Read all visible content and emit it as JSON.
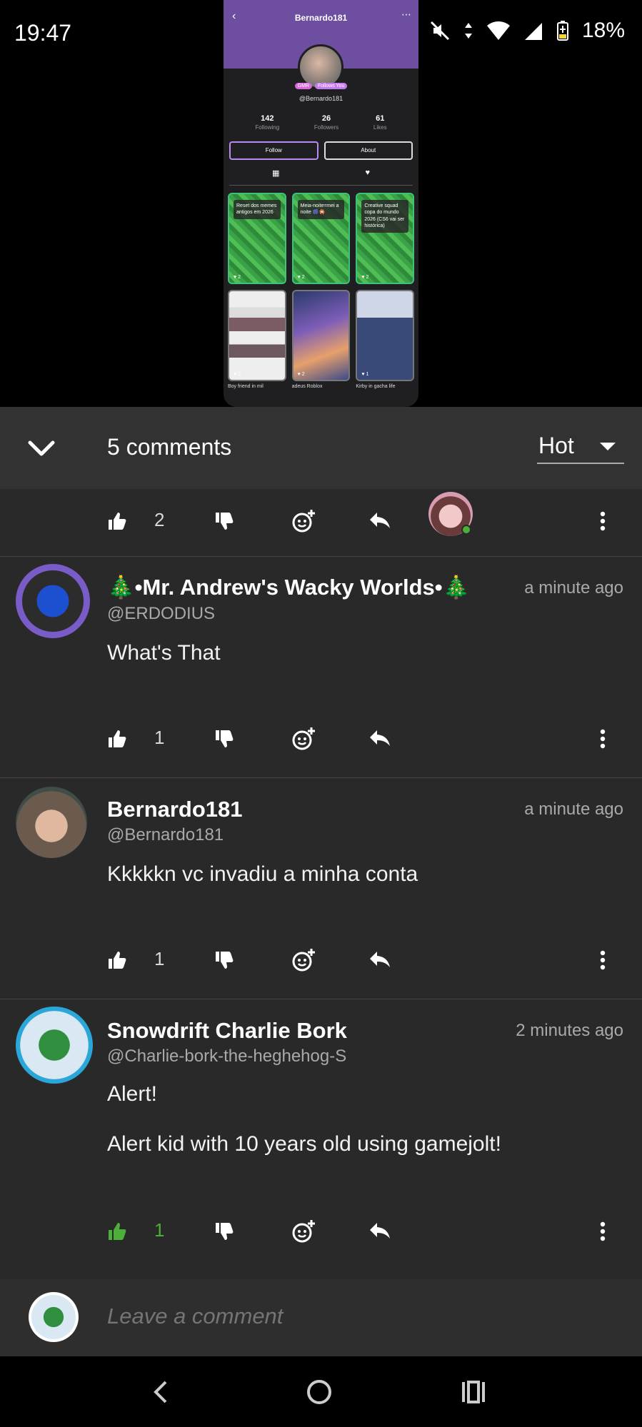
{
  "status_bar": {
    "time": "19:47",
    "battery": "18%",
    "icons": [
      "mute-icon",
      "data-icon",
      "wifi-icon",
      "signal-icon",
      "battery-icon"
    ]
  },
  "preview": {
    "title": "Bernardo181",
    "badges": [
      "GMR",
      "Follows You"
    ],
    "handle": "@Bernardo181",
    "stats": [
      {
        "value": "142",
        "label": "Following"
      },
      {
        "value": "26",
        "label": "Followers"
      },
      {
        "value": "61",
        "label": "Likes"
      }
    ],
    "buttons": {
      "follow": "Follow",
      "about": "About"
    },
    "posts": [
      {
        "caption": "Reset dos memes antigos em 2026",
        "likes": "2"
      },
      {
        "caption": "Meia-noite=mei a noite 🎆🎇",
        "likes": "2"
      },
      {
        "caption": "Creative squad copa do mundo 2026 (CS6 vai ser histórica)",
        "likes": "2"
      }
    ],
    "posts_row2": [
      {
        "label": "Boy friend in mil",
        "likes": "2"
      },
      {
        "label": "adeus Roblox",
        "likes": "2"
      },
      {
        "label": "Kirby in gacha life",
        "likes": "1"
      }
    ]
  },
  "panel": {
    "comments_count": "5 comments",
    "sort": "Hot"
  },
  "top_partial_actions": {
    "likes": "2"
  },
  "comments": [
    {
      "name": "🎄•Mr. Andrew's Wacky Worlds•🎄",
      "handle": "@ERDODIUS",
      "time": "a minute ago",
      "body": [
        "What's That"
      ],
      "likes": "1",
      "liked": false
    },
    {
      "name": "Bernardo181",
      "handle": "@Bernardo181",
      "time": "a minute ago",
      "body": [
        "Kkkkkn vc invadiu a minha conta"
      ],
      "likes": "1",
      "liked": false
    },
    {
      "name": "Snowdrift Charlie Bork",
      "handle": "@Charlie-bork-the-heghehog-S",
      "time": "2 minutes ago",
      "body": [
        "Alert!",
        "Alert kid with 10 years old using gamejolt!"
      ],
      "likes": "1",
      "liked": true
    }
  ],
  "composer": {
    "placeholder": "Leave a comment"
  },
  "colors": {
    "accent_green": "#4caf3a",
    "panel_bg": "#292929",
    "profile_purple": "#6e4ea1"
  }
}
